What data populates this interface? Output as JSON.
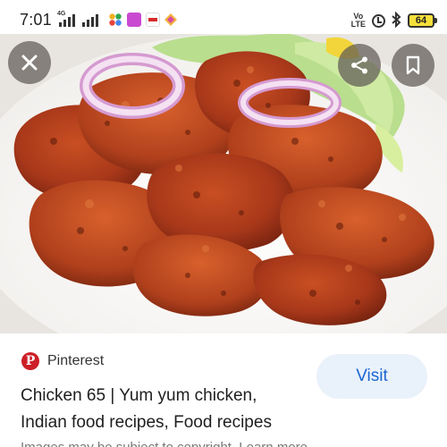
{
  "status_bar": {
    "time": "7:01",
    "network_type": "4G",
    "volte_label_top": "Vo",
    "volte_label_bottom": "LTE",
    "battery_level": "64",
    "icons": [
      "signal-icon",
      "signal-icon",
      "app-icon",
      "app-icon",
      "app-icon",
      "app-icon",
      "volte-icon",
      "alarm-icon",
      "bluetooth-icon",
      "battery-icon"
    ]
  },
  "toolbar": {
    "close_icon": "close-icon",
    "share_icon": "share-icon",
    "bookmark_icon": "bookmark-icon"
  },
  "image": {
    "icon": "chicken-65-photo"
  },
  "result": {
    "source_name": "Pinterest",
    "source_icon": "pinterest-logo",
    "visit_label": "Visit",
    "title": "Chicken 65 | Yum yum chicken, Indian food recipes, Food recipes",
    "copyright_notice": "Images may be subject to copyright. Learn more"
  },
  "colors": {
    "accent": "#1a66d2",
    "visit_bg": "#e9f1fb",
    "pinterest_red": "#cc1f27",
    "battery": "#f5df3b"
  }
}
